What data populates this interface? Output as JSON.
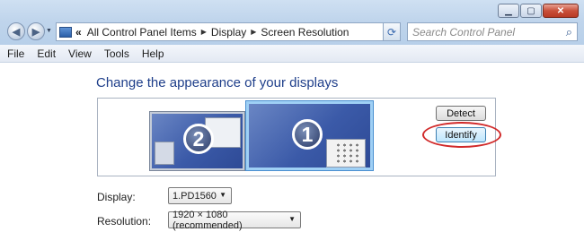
{
  "window": {
    "controls": [
      "minimize",
      "maximize",
      "close"
    ]
  },
  "nav": {
    "back_icon": "back-arrow-icon",
    "forward_icon": "forward-arrow-icon"
  },
  "address": {
    "prefix": "«",
    "crumbs": [
      "All Control Panel Items",
      "Display",
      "Screen Resolution"
    ]
  },
  "search": {
    "placeholder": "Search Control Panel"
  },
  "menu": [
    "File",
    "Edit",
    "View",
    "Tools",
    "Help"
  ],
  "main": {
    "title": "Change the appearance of your displays",
    "monitors": [
      {
        "number": "1",
        "selected": true
      },
      {
        "number": "2",
        "selected": false
      }
    ],
    "detect_label": "Detect",
    "identify_label": "Identify",
    "display_label": "Display:",
    "display_value": "1.PD1560",
    "resolution_label": "Resolution:",
    "resolution_value": "1920 × 1080 (recommended)"
  },
  "colors": {
    "title_blue": "#1e3e8a",
    "highlight_ring": "#d12a2a",
    "monitor_blue": "#3b5aa8"
  }
}
